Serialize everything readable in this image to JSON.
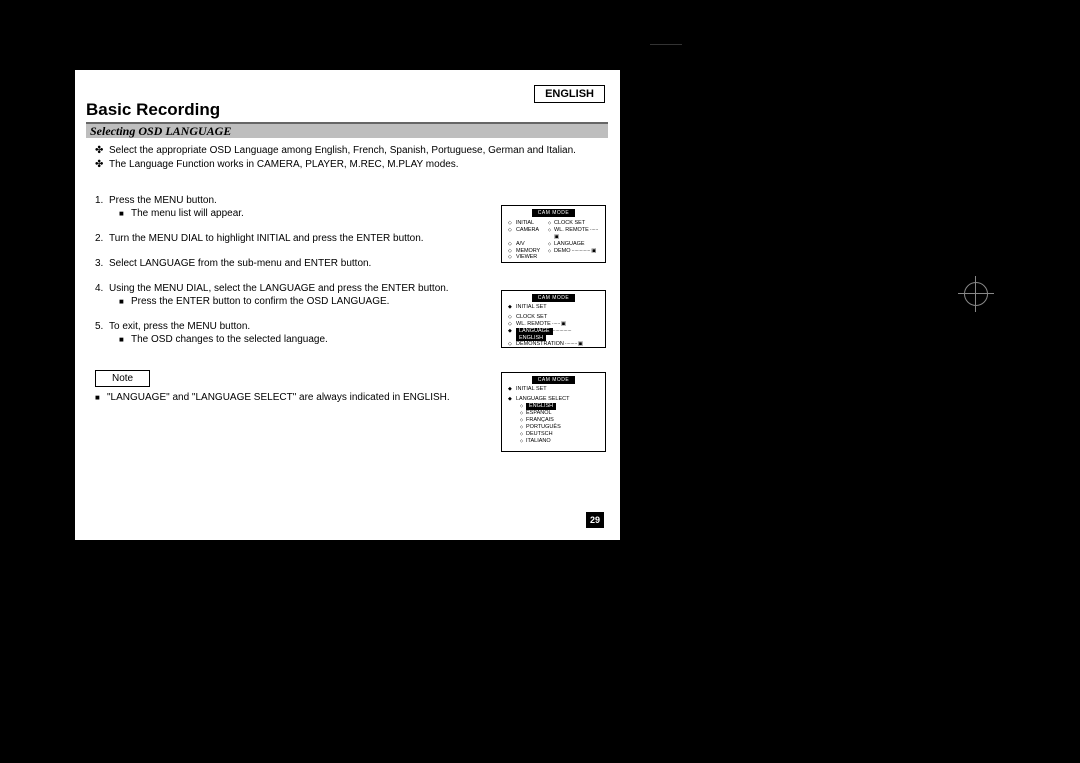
{
  "language_badge": "ENGLISH",
  "page_title": "Basic Recording",
  "section_title": "Selecting OSD LANGUAGE",
  "intro": [
    "Select the appropriate OSD Language among English, French, Spanish, Portuguese, German and Italian.",
    "The Language Function works in CAMERA, PLAYER, M.REC, M.PLAY modes."
  ],
  "steps": [
    {
      "num": "1.",
      "text": "Press the MENU button.",
      "subs": [
        "The menu list will appear."
      ]
    },
    {
      "num": "2.",
      "text": "Turn the MENU DIAL to highlight INITIAL and press the ENTER button.",
      "subs": []
    },
    {
      "num": "3.",
      "text": "Select LANGUAGE from the sub-menu and ENTER button.",
      "subs": []
    },
    {
      "num": "4.",
      "text": "Using the MENU DIAL, select the LANGUAGE and press the ENTER button.",
      "subs": [
        "Press the ENTER button to confirm the OSD LANGUAGE."
      ]
    },
    {
      "num": "5.",
      "text": "To exit, press the MENU button.",
      "subs": [
        "The OSD changes to the selected language."
      ]
    }
  ],
  "note_label": "Note",
  "note_text": "\"LANGUAGE\" and \"LANGUAGE SELECT\" are always indicated in ENGLISH.",
  "page_number": "29",
  "osd": {
    "title": "CAM  MODE",
    "screen1": {
      "left": [
        "INITIAL",
        "CAMERA",
        "A/V",
        "MEMORY",
        "VIEWER"
      ],
      "right": [
        "CLOCK  SET",
        "WL. REMOTE",
        "LANGUAGE",
        "DEMO"
      ]
    },
    "screen2": {
      "subtitle": "INITIAL SET",
      "rows": [
        {
          "label": "CLOCK  SET",
          "value": ""
        },
        {
          "label": "WL. REMOTE",
          "value": ""
        },
        {
          "label": "LANGUAGE",
          "value": "ENGLISH",
          "highlight": true
        },
        {
          "label": "DEMONSTRATION",
          "value": ""
        }
      ]
    },
    "screen3": {
      "subtitle": "INITIAL SET",
      "menu_label": "LANGUAGE SELECT",
      "options": [
        "ENGLISH",
        "ESPAÑOL",
        "FRANÇAIS",
        "PORTUGUÊS",
        "DEUTSCH",
        "ITALIANO"
      ]
    }
  }
}
